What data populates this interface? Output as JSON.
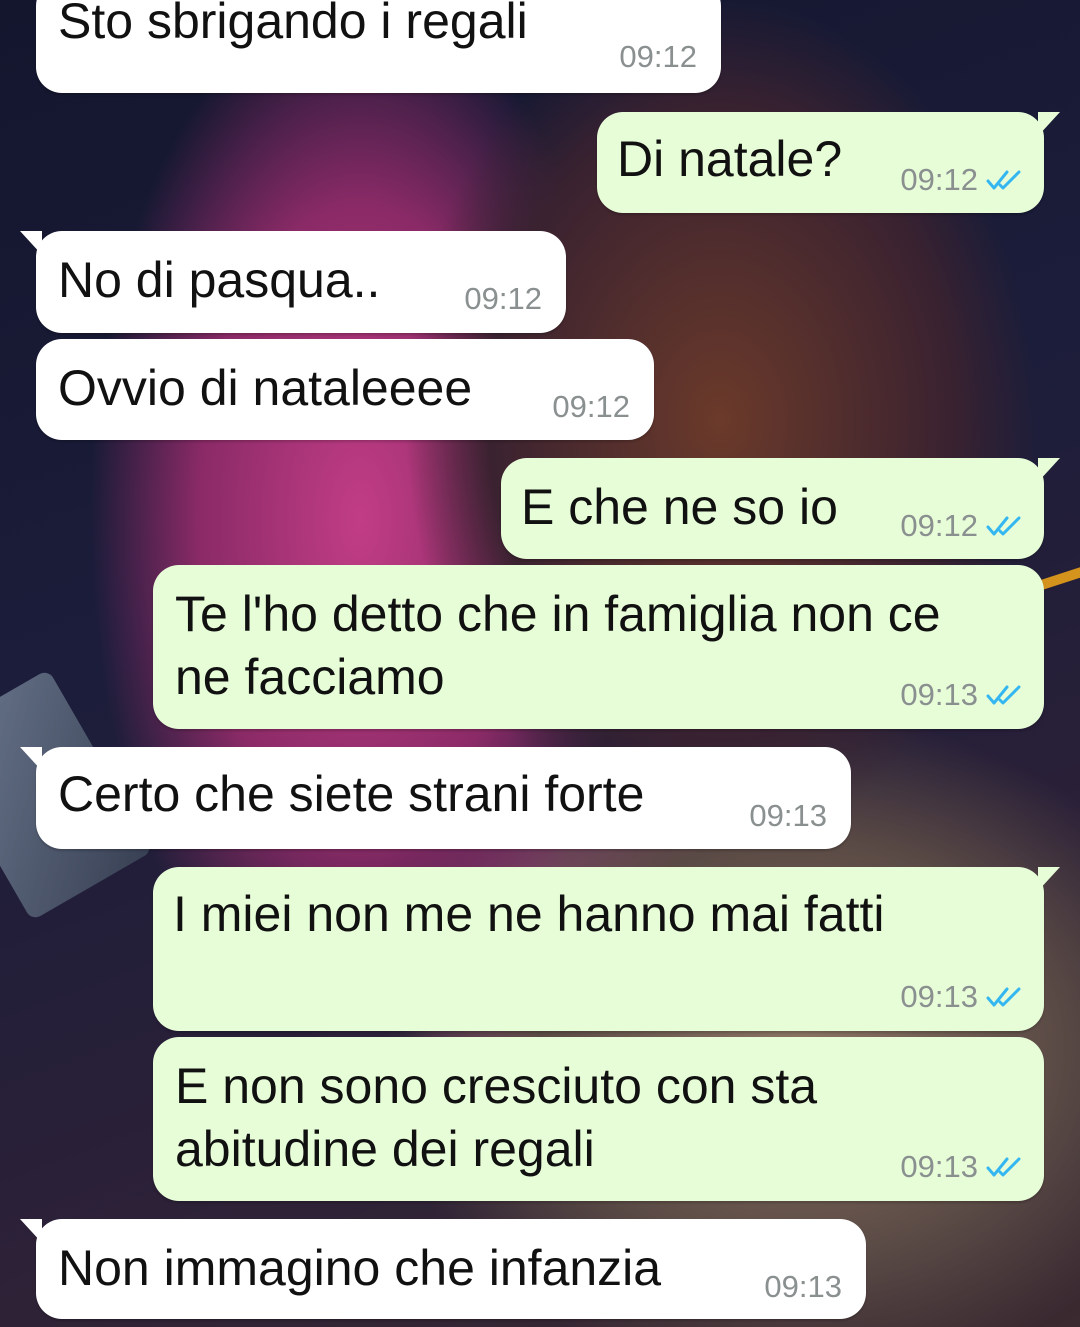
{
  "messages": [
    {
      "direction": "in",
      "text": "Sto sbrigando i regali",
      "time": "09:12"
    },
    {
      "direction": "out",
      "text": "Di natale?",
      "time": "09:12",
      "status": "read"
    },
    {
      "direction": "in",
      "text": "No di pasqua..",
      "time": "09:12"
    },
    {
      "direction": "in",
      "text": "Ovvio di nataleeee",
      "time": "09:12"
    },
    {
      "direction": "out",
      "text": "E che ne so io",
      "time": "09:12",
      "status": "read"
    },
    {
      "direction": "out",
      "text": "Te l'ho detto che in famiglia non ce\nne facciamo",
      "time": "09:13",
      "status": "read"
    },
    {
      "direction": "in",
      "text": "Certo che siete strani forte",
      "time": "09:13"
    },
    {
      "direction": "out",
      "text": "I miei non me ne hanno mai fatti",
      "time": "09:13",
      "status": "read"
    },
    {
      "direction": "out",
      "text": "E non sono cresciuto con sta\nabitudine dei regali",
      "time": "09:13",
      "status": "read"
    },
    {
      "direction": "in",
      "text": "Non immagino che infanzia",
      "time": "09:13"
    }
  ],
  "colors": {
    "incoming_bubble": "#ffffff",
    "outgoing_bubble": "#e7fdd8",
    "timestamp": "#8a8f8f",
    "read_ticks": "#34b7f1"
  },
  "icons": {
    "read_status": "double-check-icon"
  }
}
